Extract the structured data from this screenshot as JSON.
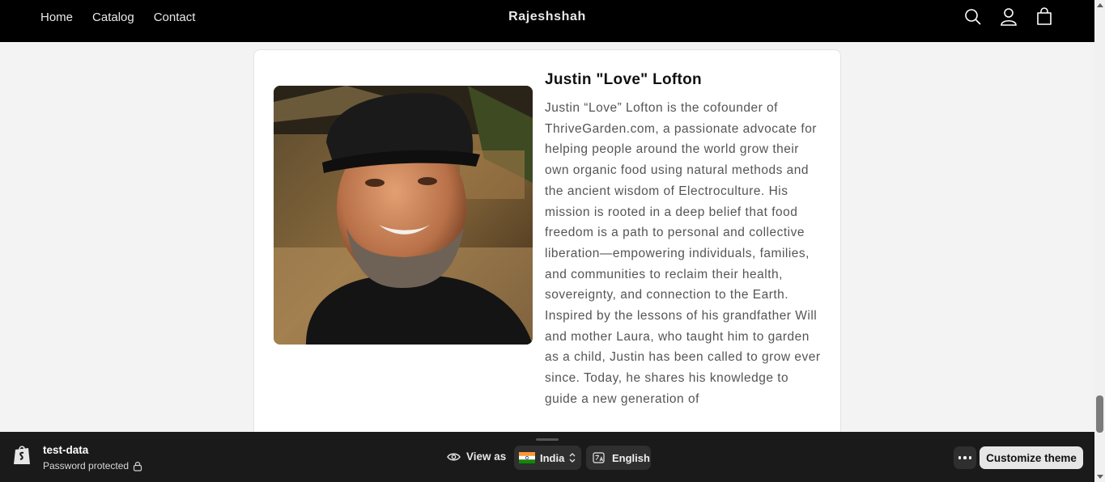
{
  "header": {
    "nav": [
      "Home",
      "Catalog",
      "Contact"
    ],
    "brand": "Rajeshshah",
    "icons": [
      "search-icon",
      "account-icon",
      "cart-icon"
    ]
  },
  "profile": {
    "name": "Justin \"Love\" Lofton",
    "bio": "Justin “Love” Lofton is the cofounder of ThriveGarden.com, a passionate advocate for helping people around the world grow their own organic food using natural methods and the ancient wisdom of Electroculture. His mission is rooted in a deep belief that food freedom is a path to personal and collective liberation—empowering individuals, families, and communities to reclaim their health, sovereignty, and connection to the Earth. Inspired by the lessons of his grandfather Will and mother Laura, who taught him to garden as a child, Justin has been called to grow ever since. Today, he shares his knowledge to guide a new generation of"
  },
  "preview_bar": {
    "store_name": "test-data",
    "status": "Password protected",
    "view_as_label": "View as",
    "country": "India",
    "language": "English",
    "customize_label": "Customize theme"
  },
  "colors": {
    "header_bg": "#000000",
    "preview_bar_bg": "#1a1a1a",
    "page_bg": "#f3f3f3"
  }
}
